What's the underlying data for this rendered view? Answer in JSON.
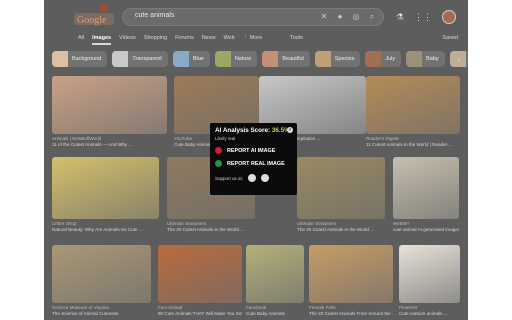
{
  "search": {
    "query": "cute animals"
  },
  "tabs": [
    "All",
    "Images",
    "Videos",
    "Shopping",
    "Forums",
    "News",
    "Web",
    "⋮ More"
  ],
  "tools_label": "Tools",
  "saved_label": "Saved",
  "chips": [
    {
      "label": "Background",
      "color": "#d8c2a2"
    },
    {
      "label": "Transparent",
      "color": "#c9c9c9"
    },
    {
      "label": "Blue",
      "color": "#8aa8c8"
    },
    {
      "label": "Nature",
      "color": "#9aa865"
    },
    {
      "label": "Beautiful",
      "color": "#c48f7a"
    },
    {
      "label": "Species",
      "color": "#bca078"
    },
    {
      "label": "July",
      "color": "#a07050"
    },
    {
      "label": "Baby",
      "color": "#9c8f7c"
    },
    {
      "label": "Animal...",
      "color": "#c0ad95"
    }
  ],
  "results": [
    {
      "src": "Animals | NowBuffWorld",
      "title": "11 of the Cutest Animals — And Why ...",
      "color": "#c9a186"
    },
    {
      "src": "YouTube",
      "title": "Cute Baby Animals Compilation ...",
      "color": "#9d7b58"
    },
    {
      "src": "",
      "title": "Cutest Animals Compilation ...",
      "color": "#c7c7c7"
    },
    {
      "src": "Reader's Digest",
      "title": "11 Cutest Animals in the World | Reader ...",
      "color": "#b58b58"
    },
    {
      "src": "Critter Shop",
      "title": "Natural Beauty: Why Are Animals So Cute ...",
      "color": "#d4c06a"
    },
    {
      "src": "Ultimate Streamers",
      "title": "The 20 Cutest Animals in the World ...",
      "color": "#8f7a5f"
    },
    {
      "src": "Ultimate Streamers",
      "title": "The 20 Cutest Animals in the World ...",
      "color": "#9a8a62"
    },
    {
      "src": "WeBiter",
      "title": "cute animal AI-generated images ...",
      "color": "#c6bfae"
    },
    {
      "src": "Science Museum of Virginia",
      "title": "The Science of Animal Cuteness",
      "color": "#aa9876"
    },
    {
      "src": "Fact Animal",
      "title": "50 Cute Animals THAT Will Make You Smile",
      "color": "#b96b3e"
    },
    {
      "src": "Facebook",
      "title": "Cute Baby Animals",
      "color": "#b4b07a"
    },
    {
      "src": "Female Felts",
      "title": "The 20 Cutest Animals From Around the ...",
      "color": "#c79c66"
    },
    {
      "src": "Pinterest",
      "title": "Cute cartoon animals ...",
      "color": "#e8e2d8"
    }
  ],
  "popup": {
    "title_prefix": "AI Analysis Score:",
    "score": "36.5%",
    "likelihood": "Likely real",
    "report_ai": "REPORT AI IMAGE",
    "report_real": "REPORT REAL IMAGE",
    "support": "Support us at:",
    "colors": {
      "ai": "#d21a3a",
      "real": "#2a8f4e",
      "score": "#b8d86b"
    }
  }
}
